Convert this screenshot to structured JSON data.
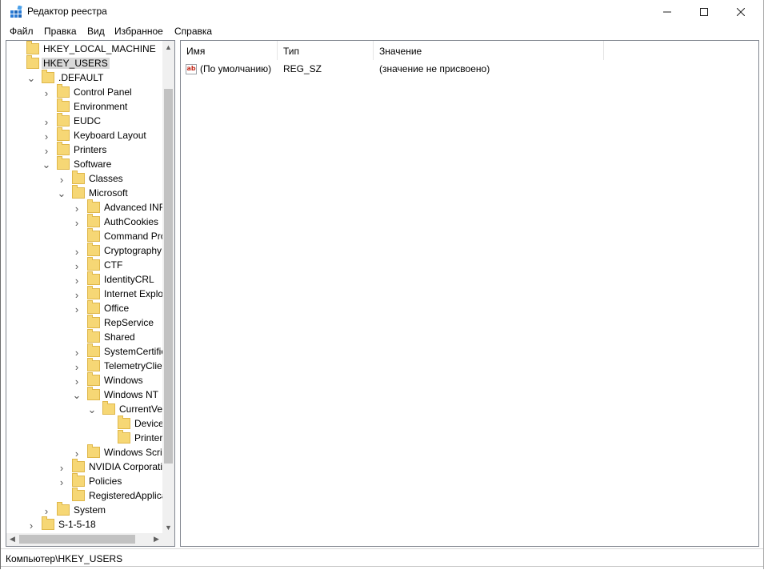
{
  "window": {
    "title": "Редактор реестра",
    "buttons": {
      "minimize": "—",
      "maximize": "☐",
      "close": "✕"
    }
  },
  "menu": [
    "Файл",
    "Правка",
    "Вид",
    "Избранное",
    "Справка"
  ],
  "tree": {
    "nodes": [
      {
        "label": "HKEY_LOCAL_MACHINE",
        "depth": 0,
        "state": "none"
      },
      {
        "label": "HKEY_USERS",
        "depth": 0,
        "state": "none",
        "selected": true
      },
      {
        "label": ".DEFAULT",
        "depth": 1,
        "state": "expanded"
      },
      {
        "label": "Control Panel",
        "depth": 2,
        "state": "collapsed"
      },
      {
        "label": "Environment",
        "depth": 2,
        "state": "none"
      },
      {
        "label": "EUDC",
        "depth": 2,
        "state": "collapsed"
      },
      {
        "label": "Keyboard Layout",
        "depth": 2,
        "state": "collapsed"
      },
      {
        "label": "Printers",
        "depth": 2,
        "state": "collapsed"
      },
      {
        "label": "Software",
        "depth": 2,
        "state": "expanded"
      },
      {
        "label": "Classes",
        "depth": 3,
        "state": "collapsed"
      },
      {
        "label": "Microsoft",
        "depth": 3,
        "state": "expanded"
      },
      {
        "label": "Advanced INF Set",
        "depth": 4,
        "state": "collapsed"
      },
      {
        "label": "AuthCookies",
        "depth": 4,
        "state": "collapsed"
      },
      {
        "label": "Command Proce",
        "depth": 4,
        "state": "none"
      },
      {
        "label": "Cryptography",
        "depth": 4,
        "state": "collapsed"
      },
      {
        "label": "CTF",
        "depth": 4,
        "state": "collapsed"
      },
      {
        "label": "IdentityCRL",
        "depth": 4,
        "state": "collapsed"
      },
      {
        "label": "Internet Explorer",
        "depth": 4,
        "state": "collapsed"
      },
      {
        "label": "Office",
        "depth": 4,
        "state": "collapsed"
      },
      {
        "label": "RepService",
        "depth": 4,
        "state": "none"
      },
      {
        "label": "Shared",
        "depth": 4,
        "state": "none"
      },
      {
        "label": "SystemCertificate",
        "depth": 4,
        "state": "collapsed"
      },
      {
        "label": "TelemetryClient",
        "depth": 4,
        "state": "collapsed"
      },
      {
        "label": "Windows",
        "depth": 4,
        "state": "collapsed"
      },
      {
        "label": "Windows NT",
        "depth": 4,
        "state": "expanded"
      },
      {
        "label": "CurrentVersio",
        "depth": 5,
        "state": "expanded"
      },
      {
        "label": "Devices",
        "depth": 6,
        "state": "none"
      },
      {
        "label": "PrinterPor",
        "depth": 6,
        "state": "none"
      },
      {
        "label": "Windows Script H",
        "depth": 4,
        "state": "collapsed"
      },
      {
        "label": "NVIDIA Corporation",
        "depth": 3,
        "state": "collapsed"
      },
      {
        "label": "Policies",
        "depth": 3,
        "state": "collapsed"
      },
      {
        "label": "RegisteredApplicatio",
        "depth": 3,
        "state": "none"
      },
      {
        "label": "System",
        "depth": 2,
        "state": "collapsed"
      },
      {
        "label": "S-1-5-18",
        "depth": 1,
        "state": "collapsed"
      }
    ]
  },
  "values": {
    "columns": [
      "Имя",
      "Тип",
      "Значение"
    ],
    "rows": [
      {
        "name": "(По умолчанию)",
        "type": "REG_SZ",
        "data": "(значение не присвоено)"
      }
    ]
  },
  "status": {
    "path": "Компьютер\\HKEY_USERS"
  }
}
